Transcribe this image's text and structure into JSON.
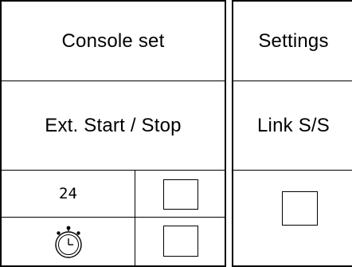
{
  "console_set": {
    "title": "Console set",
    "subtitle": "Ext. Start / Stop",
    "rows": [
      {
        "icon": "seven-segment-24-icon",
        "display_text": "24"
      },
      {
        "icon": "stopwatch-icon"
      }
    ]
  },
  "settings": {
    "title": "Settings",
    "subtitle": "Link S/S"
  }
}
